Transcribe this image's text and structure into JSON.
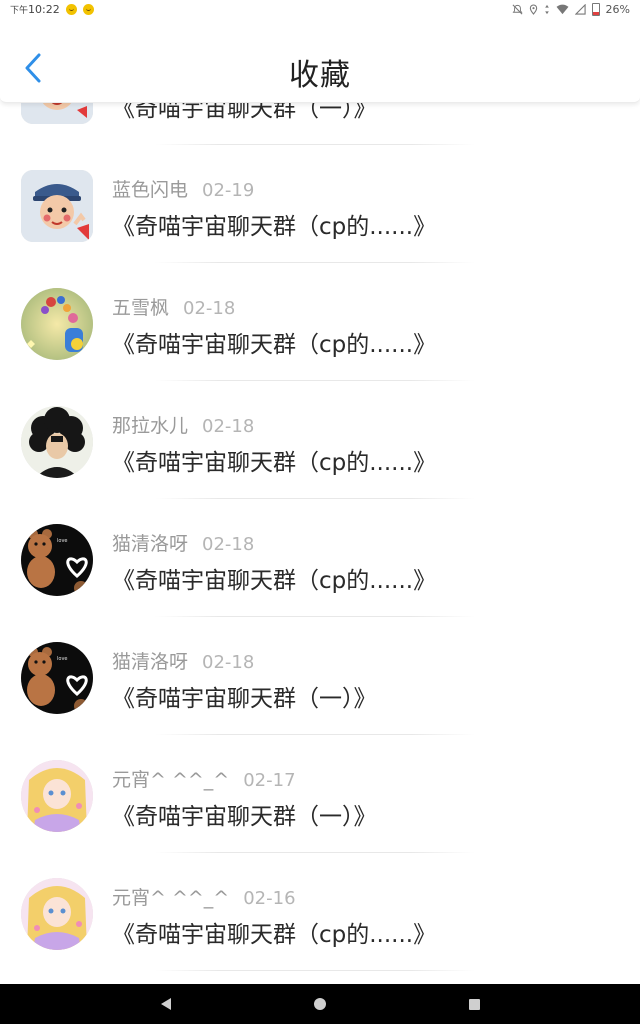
{
  "status_bar": {
    "ampm": "下午",
    "time": "10:22",
    "battery": "26%"
  },
  "header": {
    "title": "收藏"
  },
  "items": [
    {
      "name": "",
      "date": "",
      "content": "《奇喵宇宙聊天群（一）》",
      "avatar": "boy-cartoon"
    },
    {
      "name": "蓝色闪电",
      "date": "02-19",
      "content": "《奇喵宇宙聊天群（cp的......》",
      "avatar": "boy-cartoon"
    },
    {
      "name": "五雪枫",
      "date": "02-18",
      "content": "《奇喵宇宙聊天群（cp的......》",
      "avatar": "flowers"
    },
    {
      "name": "那拉水儿",
      "date": "02-18",
      "content": "《奇喵宇宙聊天群（cp的......》",
      "avatar": "curly-hair-person"
    },
    {
      "name": "猫清洛呀",
      "date": "02-18",
      "content": "《奇喵宇宙聊天群（cp的......》",
      "avatar": "bear-heart"
    },
    {
      "name": "猫清洛呀",
      "date": "02-18",
      "content": "《奇喵宇宙聊天群（一）》",
      "avatar": "bear-heart"
    },
    {
      "name": "元宵^ ^^_^",
      "date": "02-17",
      "content": "《奇喵宇宙聊天群（一）》",
      "avatar": "anime-girl"
    },
    {
      "name": "元宵^ ^^_^",
      "date": "02-16",
      "content": "《奇喵宇宙聊天群（cp的......》",
      "avatar": "anime-girl"
    }
  ],
  "colors": {
    "accent": "#2f8fe8",
    "text_primary": "#2a2a2a",
    "text_secondary": "#9a9a9a"
  }
}
